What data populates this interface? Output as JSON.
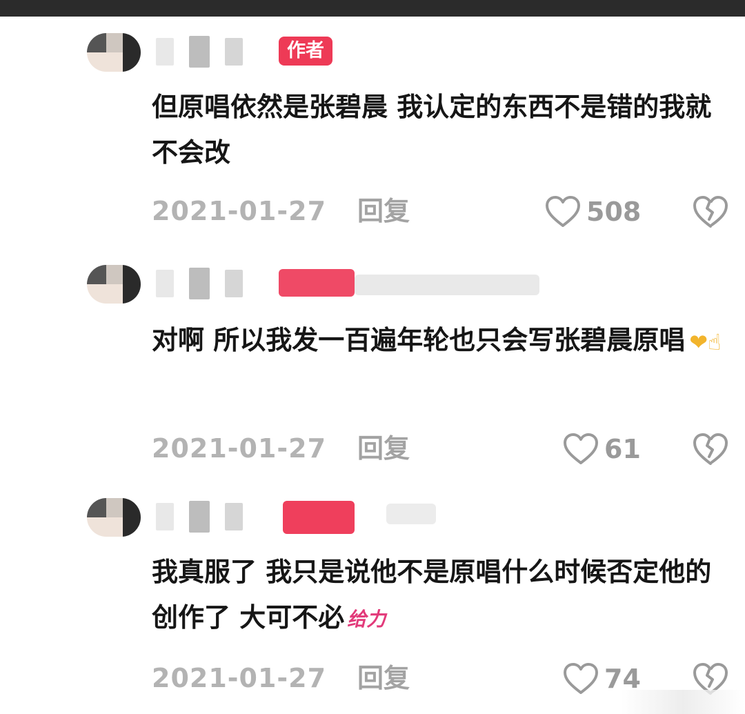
{
  "comments": [
    {
      "author_badge": "作者",
      "text": "但原唱依然是张碧晨 我认定的东西不是错的我就不会改",
      "date": "2021-01-27",
      "reply_label": "回复",
      "likes": "508"
    },
    {
      "text": "对啊 所以我发一百遍年轮也只会写张碧晨原唱",
      "emoji": "heart-hand-emoji",
      "date": "2021-01-27",
      "reply_label": "回复",
      "likes": "61"
    },
    {
      "text": "我真服了 我只是说他不是原唱什么时候否定他的创作了 大可不必",
      "sticker": "给力",
      "date": "2021-01-27",
      "reply_label": "回复",
      "likes": "74"
    }
  ],
  "colors": {
    "badge": "#ee3a56",
    "meta_text": "#b3b3b3",
    "body_text": "#161616"
  },
  "icons": [
    "heart-outline-icon",
    "broken-heart-icon"
  ]
}
